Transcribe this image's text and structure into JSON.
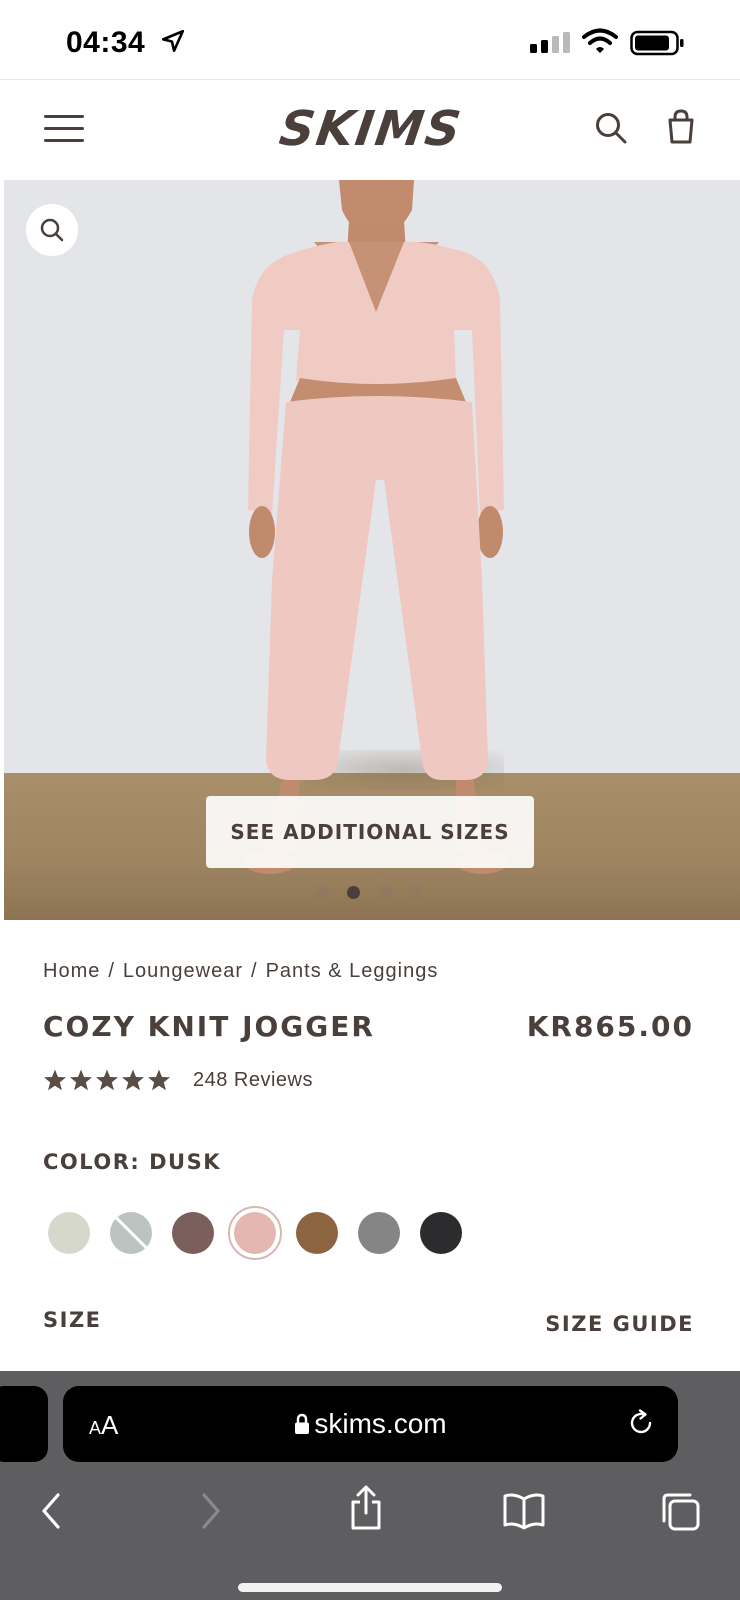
{
  "status_bar": {
    "time": "04:34"
  },
  "header": {
    "brand": "SKIMS"
  },
  "hero": {
    "see_sizes_label": "SEE ADDITIONAL SIZES",
    "carousel_total": 4,
    "carousel_active": 2
  },
  "breadcrumb": [
    "Home",
    "Loungewear",
    "Pants & Leggings"
  ],
  "product": {
    "title": "COZY KNIT JOGGER",
    "price": "KR865.00",
    "rating": 5,
    "reviews": "248 Reviews",
    "color_label": "COLOR: DUSK",
    "swatches": [
      {
        "name": "light-sage",
        "color": "#d6d8cc",
        "available": true
      },
      {
        "name": "light-gray-blue",
        "color": "#bcc4c2",
        "available": false
      },
      {
        "name": "mauve-brown",
        "color": "#7a5f5a",
        "available": true
      },
      {
        "name": "dusk",
        "color": "#e4b7b1",
        "available": true,
        "selected": true
      },
      {
        "name": "caramel",
        "color": "#8c6440",
        "available": true
      },
      {
        "name": "gray",
        "color": "#858585",
        "available": true
      },
      {
        "name": "onyx",
        "color": "#2c2c2e",
        "available": true
      }
    ],
    "size_label": "SIZE",
    "size_guide_label": "SIZE GUIDE"
  },
  "browser": {
    "text_size_label": "AA",
    "url": "skims.com"
  },
  "colors": {
    "brand_text": "#4a3f3a",
    "browser_bar": "#5e5e60"
  }
}
